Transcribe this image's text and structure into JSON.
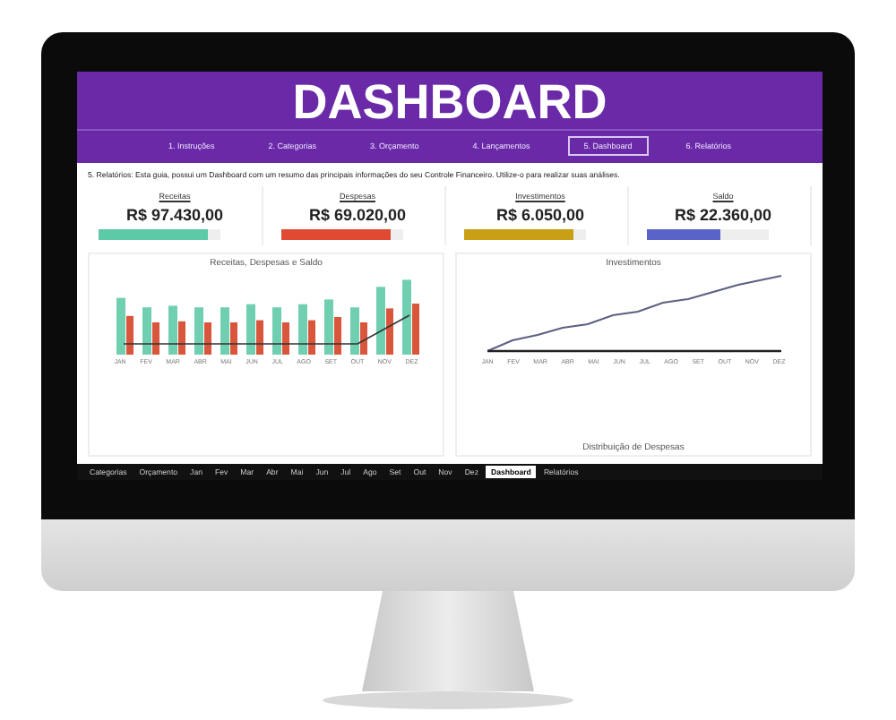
{
  "header": {
    "title": "DASHBOARD"
  },
  "nav_tabs": [
    {
      "label": "1. Instruções",
      "selected": false
    },
    {
      "label": "2. Categorias",
      "selected": false
    },
    {
      "label": "3. Orçamento",
      "selected": false
    },
    {
      "label": "4. Lançamentos",
      "selected": false
    },
    {
      "label": "5. Dashboard",
      "selected": true
    },
    {
      "label": "6. Relatórios",
      "selected": false
    }
  ],
  "instruction": "5. Relatórios: Esta guia, possui um Dashboard com um resumo das principais informações do seu Controle Financeiro. Utilize-o para realizar suas análises.",
  "cards": [
    {
      "label": "Receitas",
      "value": "R$ 97.430,00",
      "color": "#5cc9a7",
      "level": 0.9
    },
    {
      "label": "Despesas",
      "value": "R$ 69.020,00",
      "color": "#e04a32",
      "level": 0.9
    },
    {
      "label": "Investimentos",
      "value": "R$ 6.050,00",
      "color": "#c9a014",
      "level": 0.9
    },
    {
      "label": "Saldo",
      "value": "R$ 22.360,00",
      "color": "#5a64c8",
      "level": 0.6
    }
  ],
  "charts": [
    {
      "kind": "bars",
      "title": "Receitas, Despesas e Saldo",
      "months": [
        "JAN",
        "FEV",
        "MAR",
        "ABR",
        "MAI",
        "JUN",
        "JUL",
        "AGO",
        "SET",
        "OUT",
        "NOV",
        "DEZ"
      ]
    },
    {
      "kind": "lines",
      "title": "Investimentos",
      "months": [
        "JAN",
        "FEV",
        "MAR",
        "ABR",
        "MAI",
        "JUN",
        "JUL",
        "AGO",
        "SET",
        "OUT",
        "NOV",
        "DEZ"
      ],
      "subtitle": "Distribuição de Despesas"
    }
  ],
  "sheet_tabs": [
    {
      "label": "Categorias",
      "selected": false
    },
    {
      "label": "Orçamento",
      "selected": false
    },
    {
      "label": "Jan",
      "selected": false
    },
    {
      "label": "Fev",
      "selected": false
    },
    {
      "label": "Mar",
      "selected": false
    },
    {
      "label": "Abr",
      "selected": false
    },
    {
      "label": "Mai",
      "selected": false
    },
    {
      "label": "Jun",
      "selected": false
    },
    {
      "label": "Jul",
      "selected": false
    },
    {
      "label": "Ago",
      "selected": false
    },
    {
      "label": "Set",
      "selected": false
    },
    {
      "label": "Out",
      "selected": false
    },
    {
      "label": "Nov",
      "selected": false
    },
    {
      "label": "Dez",
      "selected": false
    },
    {
      "label": "Dashboard",
      "selected": true
    },
    {
      "label": "Relatórios",
      "selected": false
    }
  ]
}
